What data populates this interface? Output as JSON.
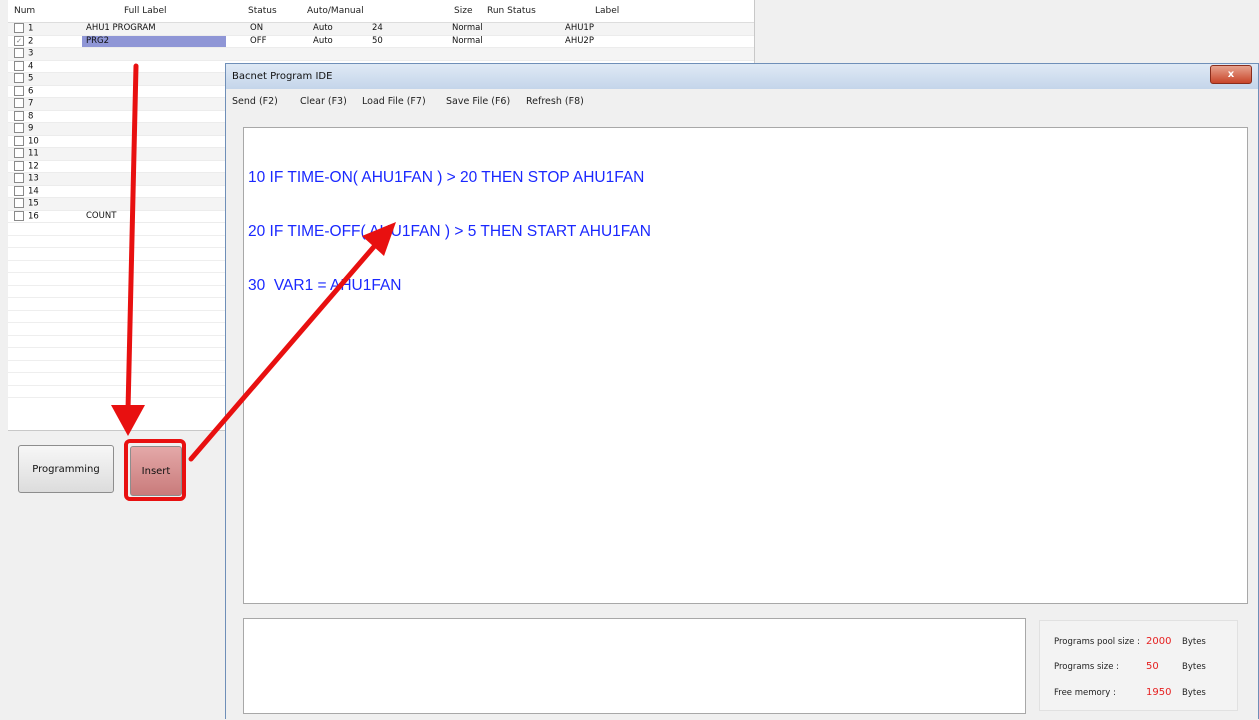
{
  "table": {
    "headers": [
      "Num",
      "Full Label",
      "Status",
      "Auto/Manual",
      "Size",
      "Run Status",
      "Label"
    ],
    "rows": [
      {
        "num": "1",
        "checked": false,
        "full_label": "AHU1 PROGRAM",
        "status": "ON",
        "auto_manual": "Auto",
        "size": "24",
        "run_status": "Normal",
        "label": "AHU1P"
      },
      {
        "num": "2",
        "checked": true,
        "full_label": "PRG2",
        "status": "OFF",
        "auto_manual": "Auto",
        "size": "50",
        "run_status": "Normal",
        "label": "AHU2P"
      },
      {
        "num": "3",
        "checked": false,
        "full_label": "",
        "status": "",
        "auto_manual": "",
        "size": "",
        "run_status": "",
        "label": ""
      },
      {
        "num": "4",
        "checked": false,
        "full_label": "",
        "status": "",
        "auto_manual": "",
        "size": "",
        "run_status": "",
        "label": ""
      },
      {
        "num": "5",
        "checked": false,
        "full_label": "",
        "status": "",
        "auto_manual": "",
        "size": "",
        "run_status": "",
        "label": ""
      },
      {
        "num": "6",
        "checked": false,
        "full_label": "",
        "status": "",
        "auto_manual": "",
        "size": "",
        "run_status": "",
        "label": ""
      },
      {
        "num": "7",
        "checked": false,
        "full_label": "",
        "status": "",
        "auto_manual": "",
        "size": "",
        "run_status": "",
        "label": ""
      },
      {
        "num": "8",
        "checked": false,
        "full_label": "",
        "status": "",
        "auto_manual": "",
        "size": "",
        "run_status": "",
        "label": ""
      },
      {
        "num": "9",
        "checked": false,
        "full_label": "",
        "status": "",
        "auto_manual": "",
        "size": "",
        "run_status": "",
        "label": ""
      },
      {
        "num": "10",
        "checked": false,
        "full_label": "",
        "status": "",
        "auto_manual": "",
        "size": "",
        "run_status": "",
        "label": ""
      },
      {
        "num": "11",
        "checked": false,
        "full_label": "",
        "status": "",
        "auto_manual": "",
        "size": "",
        "run_status": "",
        "label": ""
      },
      {
        "num": "12",
        "checked": false,
        "full_label": "",
        "status": "",
        "auto_manual": "",
        "size": "",
        "run_status": "",
        "label": ""
      },
      {
        "num": "13",
        "checked": false,
        "full_label": "",
        "status": "",
        "auto_manual": "",
        "size": "",
        "run_status": "",
        "label": ""
      },
      {
        "num": "14",
        "checked": false,
        "full_label": "",
        "status": "",
        "auto_manual": "",
        "size": "",
        "run_status": "",
        "label": ""
      },
      {
        "num": "15",
        "checked": false,
        "full_label": "",
        "status": "",
        "auto_manual": "",
        "size": "",
        "run_status": "",
        "label": ""
      },
      {
        "num": "16",
        "checked": false,
        "full_label": "COUNT",
        "status": "",
        "auto_manual": "",
        "size": "",
        "run_status": "",
        "label": ""
      }
    ]
  },
  "buttons": {
    "programming": "Programming",
    "insert": "Insert"
  },
  "ide": {
    "title": "Bacnet Program IDE",
    "close": "x",
    "menu": [
      "Send (F2)",
      "Clear (F3)",
      "Load File (F7)",
      "Save File (F6)",
      "Refresh (F8)"
    ],
    "code_lines": [
      "10 IF TIME-ON( AHU1FAN ) > 20 THEN STOP AHU1FAN",
      "20 IF TIME-OFF( AHU1FAN ) > 5 THEN START AHU1FAN",
      "30  VAR1 = AHU1FAN"
    ],
    "memory": {
      "pool_label": "Programs pool size :",
      "pool_value": "2000",
      "size_label": "Programs size     :",
      "size_value": "50",
      "free_label": "Free memory       :",
      "free_value": "1950",
      "unit": "Bytes"
    }
  },
  "colors": {
    "annotation_arrow": "#e81010",
    "code_text": "#1a28ff",
    "memory_value": "#e62020",
    "selection": "#8f96d6"
  }
}
